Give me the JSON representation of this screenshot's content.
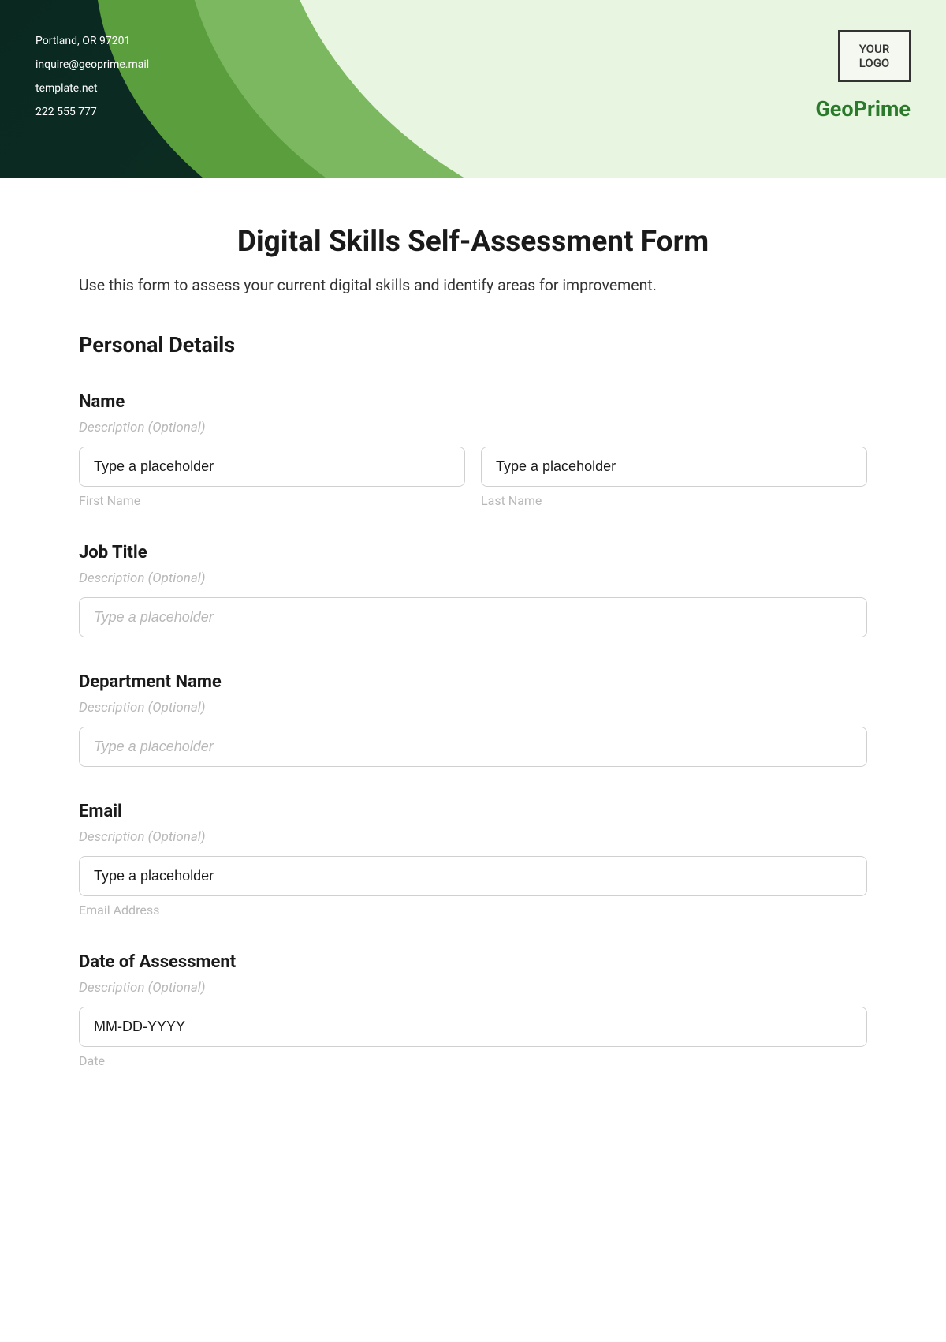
{
  "header": {
    "contact": {
      "address": "Portland, OR 97201",
      "email": "inquire@geoprime.mail",
      "website": "template.net",
      "phone": "222 555 777"
    },
    "logo_line1": "YOUR",
    "logo_line2": "LOGO",
    "company_name": "GeoPrime"
  },
  "form": {
    "title": "Digital Skills Self-Assessment Form",
    "subtitle": "Use this form to assess your current digital skills and identify areas for improvement.",
    "section_heading": "Personal Details",
    "fields": {
      "name": {
        "label": "Name",
        "description": "Description (Optional)",
        "first_name_value": "Type a placeholder",
        "first_name_sublabel": "First Name",
        "last_name_value": "Type a placeholder",
        "last_name_sublabel": "Last Name"
      },
      "job_title": {
        "label": "Job Title",
        "description": "Description (Optional)",
        "placeholder": "Type a placeholder"
      },
      "department": {
        "label": "Department Name",
        "description": "Description (Optional)",
        "placeholder": "Type a placeholder"
      },
      "email": {
        "label": "Email",
        "description": "Description (Optional)",
        "value": "Type a placeholder",
        "sublabel": "Email Address"
      },
      "date": {
        "label": "Date of Assessment",
        "description": "Description (Optional)",
        "value": "MM-DD-YYYY",
        "sublabel": "Date"
      }
    }
  }
}
